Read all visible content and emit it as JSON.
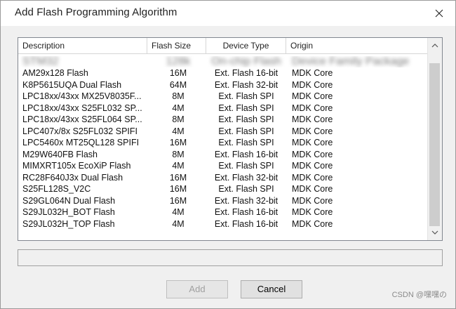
{
  "dialog": {
    "title": "Add Flash Programming Algorithm"
  },
  "columns": [
    "Description",
    "Flash Size",
    "Device Type",
    "Origin"
  ],
  "partial_row": {
    "description": "STM32",
    "size": "128k",
    "type": "On-chip Flash",
    "origin": "Device Family Package"
  },
  "rows": [
    {
      "description": "AM29x128 Flash",
      "size": "16M",
      "type": "Ext. Flash 16-bit",
      "origin": "MDK Core"
    },
    {
      "description": "K8P5615UQA Dual Flash",
      "size": "64M",
      "type": "Ext. Flash 32-bit",
      "origin": "MDK Core"
    },
    {
      "description": "LPC18xx/43xx MX25V8035F...",
      "size": "8M",
      "type": "Ext. Flash SPI",
      "origin": "MDK Core"
    },
    {
      "description": "LPC18xx/43xx S25FL032 SP...",
      "size": "4M",
      "type": "Ext. Flash SPI",
      "origin": "MDK Core"
    },
    {
      "description": "LPC18xx/43xx S25FL064 SP...",
      "size": "8M",
      "type": "Ext. Flash SPI",
      "origin": "MDK Core"
    },
    {
      "description": "LPC407x/8x S25FL032 SPIFI",
      "size": "4M",
      "type": "Ext. Flash SPI",
      "origin": "MDK Core"
    },
    {
      "description": "LPC5460x MT25QL128 SPIFI",
      "size": "16M",
      "type": "Ext. Flash SPI",
      "origin": "MDK Core"
    },
    {
      "description": "M29W640FB Flash",
      "size": "8M",
      "type": "Ext. Flash 16-bit",
      "origin": "MDK Core"
    },
    {
      "description": "MIMXRT105x EcoXiP Flash",
      "size": "4M",
      "type": "Ext. Flash SPI",
      "origin": "MDK Core"
    },
    {
      "description": "RC28F640J3x Dual Flash",
      "size": "16M",
      "type": "Ext. Flash 32-bit",
      "origin": "MDK Core"
    },
    {
      "description": "S25FL128S_V2C",
      "size": "16M",
      "type": "Ext. Flash SPI",
      "origin": "MDK Core"
    },
    {
      "description": "S29GL064N Dual Flash",
      "size": "16M",
      "type": "Ext. Flash 32-bit",
      "origin": "MDK Core"
    },
    {
      "description": "S29JL032H_BOT Flash",
      "size": "4M",
      "type": "Ext. Flash 16-bit",
      "origin": "MDK Core"
    },
    {
      "description": "S29JL032H_TOP Flash",
      "size": "4M",
      "type": "Ext. Flash 16-bit",
      "origin": "MDK Core"
    }
  ],
  "status_text": "",
  "buttons": {
    "add": "Add",
    "cancel": "Cancel"
  },
  "watermark": "CSDN @嘿嘿の"
}
